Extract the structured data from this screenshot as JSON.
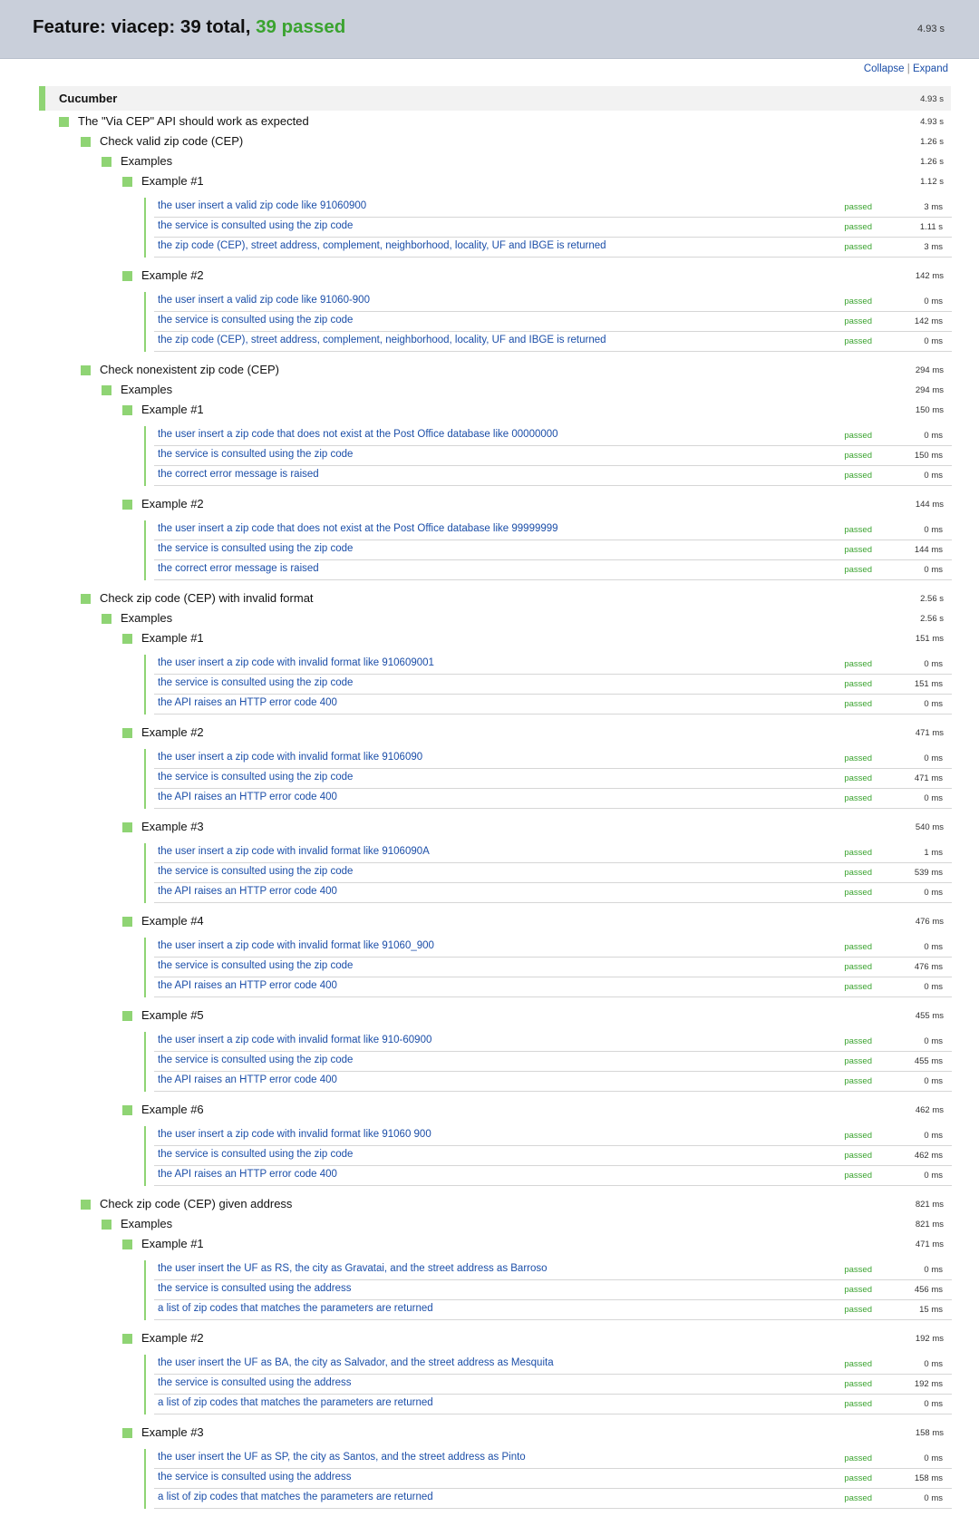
{
  "header": {
    "title_prefix": "Feature: viacep: 39 total, ",
    "title_passed": "39 passed",
    "duration": "4.93 s"
  },
  "controls": {
    "collapse": "Collapse",
    "separator": "|",
    "expand": "Expand"
  },
  "status_label": "passed",
  "colors": {
    "pass": "#8fd474",
    "pass_text": "#3aa32f",
    "link": "#1b4ea8",
    "header_bg": "#c9cfda"
  },
  "tree": {
    "name": "Cucumber",
    "duration": "4.93 s",
    "feature": {
      "name": "The \"Via CEP\" API should work as expected",
      "duration": "4.93 s",
      "scenarios": [
        {
          "name": "Check valid zip code (CEP)",
          "duration": "1.26 s",
          "examples_label": "Examples",
          "examples_duration": "1.26 s",
          "examples": [
            {
              "name": "Example #1",
              "duration": "1.12 s",
              "steps": [
                {
                  "text": "the user insert a valid zip code like 91060900",
                  "duration": "3 ms"
                },
                {
                  "text": "the service is consulted using the zip code",
                  "duration": "1.11 s"
                },
                {
                  "text": "the zip code (CEP), street address, complement, neighborhood, locality, UF and IBGE is returned",
                  "duration": "3 ms"
                }
              ]
            },
            {
              "name": "Example #2",
              "duration": "142 ms",
              "steps": [
                {
                  "text": "the user insert a valid zip code like 91060-900",
                  "duration": "0 ms"
                },
                {
                  "text": "the service is consulted using the zip code",
                  "duration": "142 ms"
                },
                {
                  "text": "the zip code (CEP), street address, complement, neighborhood, locality, UF and IBGE is returned",
                  "duration": "0 ms"
                }
              ]
            }
          ]
        },
        {
          "name": "Check nonexistent zip code (CEP)",
          "duration": "294 ms",
          "examples_label": "Examples",
          "examples_duration": "294 ms",
          "examples": [
            {
              "name": "Example #1",
              "duration": "150 ms",
              "steps": [
                {
                  "text": "the user insert a zip code that does not exist at the Post Office database like 00000000",
                  "duration": "0 ms"
                },
                {
                  "text": "the service is consulted using the zip code",
                  "duration": "150 ms"
                },
                {
                  "text": "the correct error message is raised",
                  "duration": "0 ms"
                }
              ]
            },
            {
              "name": "Example #2",
              "duration": "144 ms",
              "steps": [
                {
                  "text": "the user insert a zip code that does not exist at the Post Office database like 99999999",
                  "duration": "0 ms"
                },
                {
                  "text": "the service is consulted using the zip code",
                  "duration": "144 ms"
                },
                {
                  "text": "the correct error message is raised",
                  "duration": "0 ms"
                }
              ]
            }
          ]
        },
        {
          "name": "Check zip code (CEP) with invalid format",
          "duration": "2.56 s",
          "examples_label": "Examples",
          "examples_duration": "2.56 s",
          "examples": [
            {
              "name": "Example #1",
              "duration": "151 ms",
              "steps": [
                {
                  "text": "the user insert a zip code with invalid format like 910609001",
                  "duration": "0 ms"
                },
                {
                  "text": "the service is consulted using the zip code",
                  "duration": "151 ms"
                },
                {
                  "text": "the API raises an HTTP error code 400",
                  "duration": "0 ms"
                }
              ]
            },
            {
              "name": "Example #2",
              "duration": "471 ms",
              "steps": [
                {
                  "text": "the user insert a zip code with invalid format like 9106090",
                  "duration": "0 ms"
                },
                {
                  "text": "the service is consulted using the zip code",
                  "duration": "471 ms"
                },
                {
                  "text": "the API raises an HTTP error code 400",
                  "duration": "0 ms"
                }
              ]
            },
            {
              "name": "Example #3",
              "duration": "540 ms",
              "steps": [
                {
                  "text": "the user insert a zip code with invalid format like 9106090A",
                  "duration": "1 ms"
                },
                {
                  "text": "the service is consulted using the zip code",
                  "duration": "539 ms"
                },
                {
                  "text": "the API raises an HTTP error code 400",
                  "duration": "0 ms"
                }
              ]
            },
            {
              "name": "Example #4",
              "duration": "476 ms",
              "steps": [
                {
                  "text": "the user insert a zip code with invalid format like 91060_900",
                  "duration": "0 ms"
                },
                {
                  "text": "the service is consulted using the zip code",
                  "duration": "476 ms"
                },
                {
                  "text": "the API raises an HTTP error code 400",
                  "duration": "0 ms"
                }
              ]
            },
            {
              "name": "Example #5",
              "duration": "455 ms",
              "steps": [
                {
                  "text": "the user insert a zip code with invalid format like 910-60900",
                  "duration": "0 ms"
                },
                {
                  "text": "the service is consulted using the zip code",
                  "duration": "455 ms"
                },
                {
                  "text": "the API raises an HTTP error code 400",
                  "duration": "0 ms"
                }
              ]
            },
            {
              "name": "Example #6",
              "duration": "462 ms",
              "steps": [
                {
                  "text": "the user insert a zip code with invalid format like 91060 900",
                  "duration": "0 ms"
                },
                {
                  "text": "the service is consulted using the zip code",
                  "duration": "462 ms"
                },
                {
                  "text": "the API raises an HTTP error code 400",
                  "duration": "0 ms"
                }
              ]
            }
          ]
        },
        {
          "name": "Check zip code (CEP) given address",
          "duration": "821 ms",
          "examples_label": "Examples",
          "examples_duration": "821 ms",
          "examples": [
            {
              "name": "Example #1",
              "duration": "471 ms",
              "steps": [
                {
                  "text": "the user insert the UF as RS, the city as Gravatai, and the street address as Barroso",
                  "duration": "0 ms"
                },
                {
                  "text": "the service is consulted using the address",
                  "duration": "456 ms"
                },
                {
                  "text": "a list of zip codes that matches the parameters are returned",
                  "duration": "15 ms"
                }
              ]
            },
            {
              "name": "Example #2",
              "duration": "192 ms",
              "steps": [
                {
                  "text": "the user insert the UF as BA, the city as Salvador, and the street address as Mesquita",
                  "duration": "0 ms"
                },
                {
                  "text": "the service is consulted using the address",
                  "duration": "192 ms"
                },
                {
                  "text": "a list of zip codes that matches the parameters are returned",
                  "duration": "0 ms"
                }
              ]
            },
            {
              "name": "Example #3",
              "duration": "158 ms",
              "steps": [
                {
                  "text": "the user insert the UF as SP, the city as Santos, and the street address as Pinto",
                  "duration": "0 ms"
                },
                {
                  "text": "the service is consulted using the address",
                  "duration": "158 ms"
                },
                {
                  "text": "a list of zip codes that matches the parameters are returned",
                  "duration": "0 ms"
                }
              ]
            }
          ]
        }
      ]
    }
  }
}
